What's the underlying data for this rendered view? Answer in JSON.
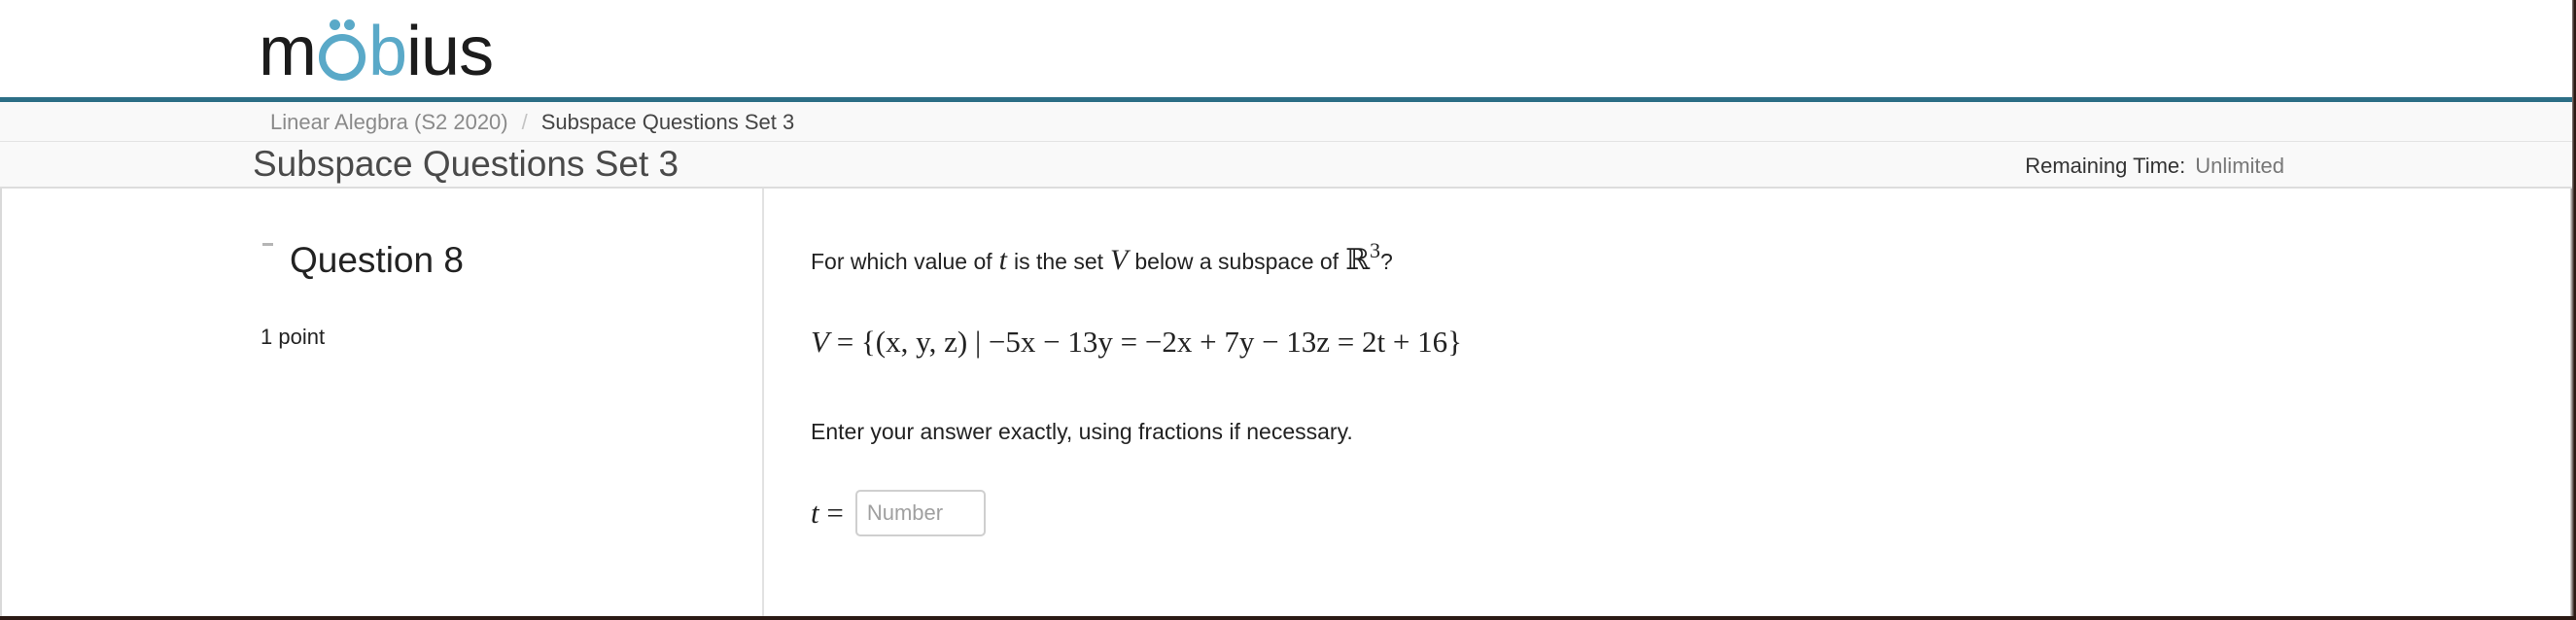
{
  "brand": {
    "logo_prefix": "m",
    "logo_suffix": "ius",
    "logo_b": "b"
  },
  "breadcrumb": {
    "course": "Linear Alegbra (S2 2020)",
    "separator": "/",
    "current": "Subspace Questions Set 3"
  },
  "page": {
    "title": "Subspace Questions Set 3",
    "timer_label": "Remaining Time:",
    "timer_value": "Unlimited"
  },
  "question": {
    "toggle_symbol": "-",
    "title": "Question 8",
    "points": "1 point",
    "prompt_part1": "For which value of",
    "prompt_var_t": "t",
    "prompt_part2": "is the set",
    "prompt_var_V": "V",
    "prompt_part3": "below a subspace of",
    "prompt_space": "ℝ",
    "prompt_exponent": "3",
    "prompt_end": "?",
    "formula_lhs": "V",
    "formula_rhs": " = {(x, y, z)  |  −5x − 13y = −2x + 7y − 13z = 2t + 16}",
    "instruction": "Enter your answer exactly, using fractions if necessary.",
    "answer_var": "t",
    "answer_eq": " =",
    "answer_placeholder": "Number",
    "answer_value": ""
  },
  "colors": {
    "accent": "#2c6e86",
    "logo_blue": "#5aa9c8"
  }
}
